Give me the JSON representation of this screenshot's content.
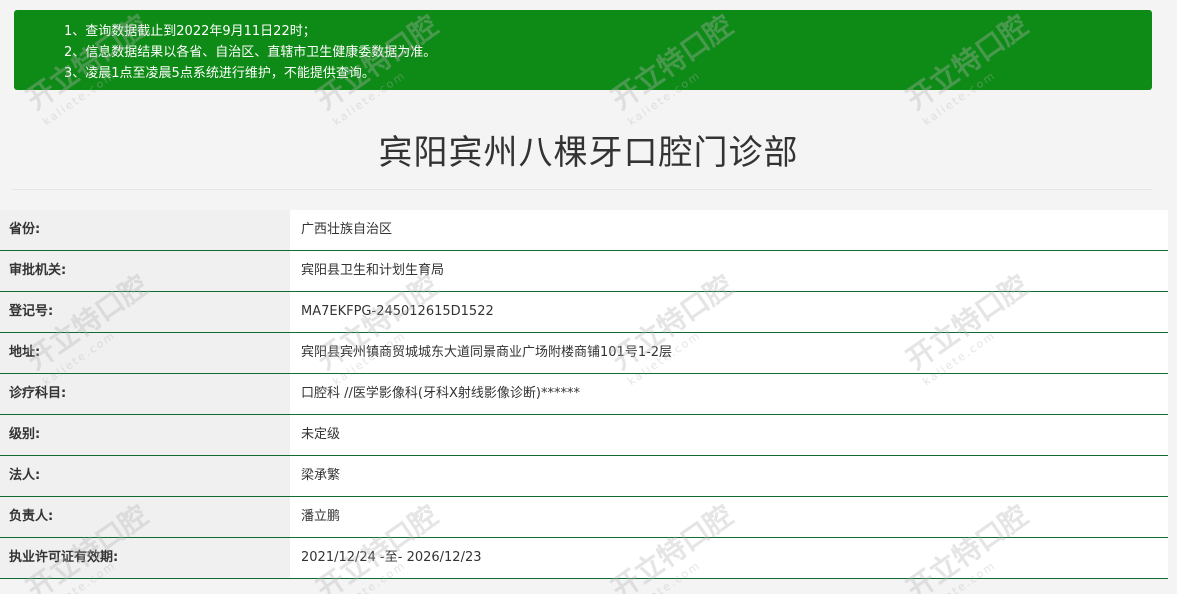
{
  "notice": {
    "lines": [
      "1、查询数据截止到2022年9月11日22时；",
      "2、信息数据结果以各省、自治区、直辖市卫生健康委数据为准。",
      "3、凌晨1点至凌晨5点系统进行维护，不能提供查询。"
    ]
  },
  "page_title": "宾阳宾州八棵牙口腔门诊部",
  "watermark": {
    "text": "开立特口腔",
    "sub": "kaliete.com"
  },
  "rows": [
    {
      "label": "省份:",
      "value": "广西壮族自治区"
    },
    {
      "label": "审批机关:",
      "value": "宾阳县卫生和计划生育局"
    },
    {
      "label": "登记号:",
      "value": "MA7EKFPG-245012615D1522"
    },
    {
      "label": "地址:",
      "value": "宾阳县宾州镇商贸城城东大道同景商业广场附楼商铺101号1-2层"
    },
    {
      "label": "诊疗科目:",
      "value": "口腔科 //医学影像科(牙科X射线影像诊断)******"
    },
    {
      "label": "级别:",
      "value": "未定级"
    },
    {
      "label": "法人:",
      "value": "梁承繁"
    },
    {
      "label": "负责人:",
      "value": "潘立鹏"
    },
    {
      "label": "执业许可证有效期:",
      "value": "2021/12/24 -至- 2026/12/23"
    }
  ]
}
